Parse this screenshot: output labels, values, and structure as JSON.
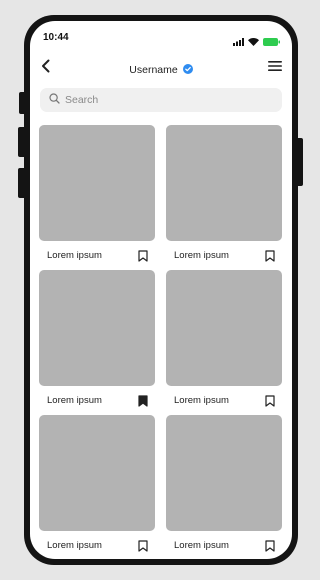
{
  "status_bar": {
    "time": "10:44",
    "icons": [
      "signal-icon",
      "wifi-icon",
      "battery-icon"
    ],
    "battery_color": "#2ecc4f"
  },
  "nav": {
    "back_icon": "chevron-left-icon",
    "title": "Username",
    "verified_icon": "verified-badge-icon",
    "verified_color": "#2f8cf0",
    "menu_icon": "hamburger-menu-icon"
  },
  "search": {
    "icon": "search-icon",
    "placeholder": "Search"
  },
  "posts": [
    {
      "label": "Lorem ipsum",
      "bookmarked": false
    },
    {
      "label": "Lorem ipsum",
      "bookmarked": false
    },
    {
      "label": "Lorem ipsum",
      "bookmarked": true
    },
    {
      "label": "Lorem ipsum",
      "bookmarked": false
    },
    {
      "label": "Lorem ipsum",
      "bookmarked": false
    },
    {
      "label": "Lorem ipsum",
      "bookmarked": false
    }
  ],
  "colors": {
    "background": "#e6e6e6",
    "phone_frame": "#141414",
    "thumbnail": "#b3b3b3",
    "search_bg": "#f0f0f0"
  }
}
